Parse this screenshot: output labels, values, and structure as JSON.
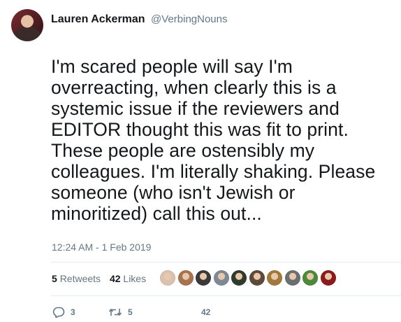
{
  "tweet": {
    "display_name": "Lauren Ackerman",
    "handle": "@VerbingNouns",
    "text_lines": [
      "I'm scared people will say I'm",
      "overreacting, when clearly this is a",
      "systemic issue if the reviewers and",
      "EDITOR thought this was fit to print.",
      "These people are ostensibly my",
      "colleagues. I'm literally shaking. Please",
      "someone (who isn't Jewish or",
      "minoritized) call this out..."
    ],
    "timestamp": "12:24 AM - 1 Feb 2019"
  },
  "stats": {
    "retweets_count": "5",
    "retweets_label": "Retweets",
    "likes_count": "42",
    "likes_label": "Likes"
  },
  "likers": [
    {
      "color": "#d9c3b0"
    },
    {
      "color": "#a8734f"
    },
    {
      "color": "#3a3a3a"
    },
    {
      "color": "#7d8a96"
    },
    {
      "color": "#2f3b2b"
    },
    {
      "color": "#5c4a3a"
    },
    {
      "color": "#a07a3c"
    },
    {
      "color": "#6b6f73"
    },
    {
      "color": "#4b8a3a"
    },
    {
      "color": "#8a1c1c"
    }
  ],
  "actions": {
    "reply_count": "3",
    "retweet_count": "5",
    "like_count": "42"
  },
  "icons": {
    "reply": "speech-bubble-icon",
    "retweet": "retweet-arrows-icon",
    "like": "heart-icon"
  }
}
